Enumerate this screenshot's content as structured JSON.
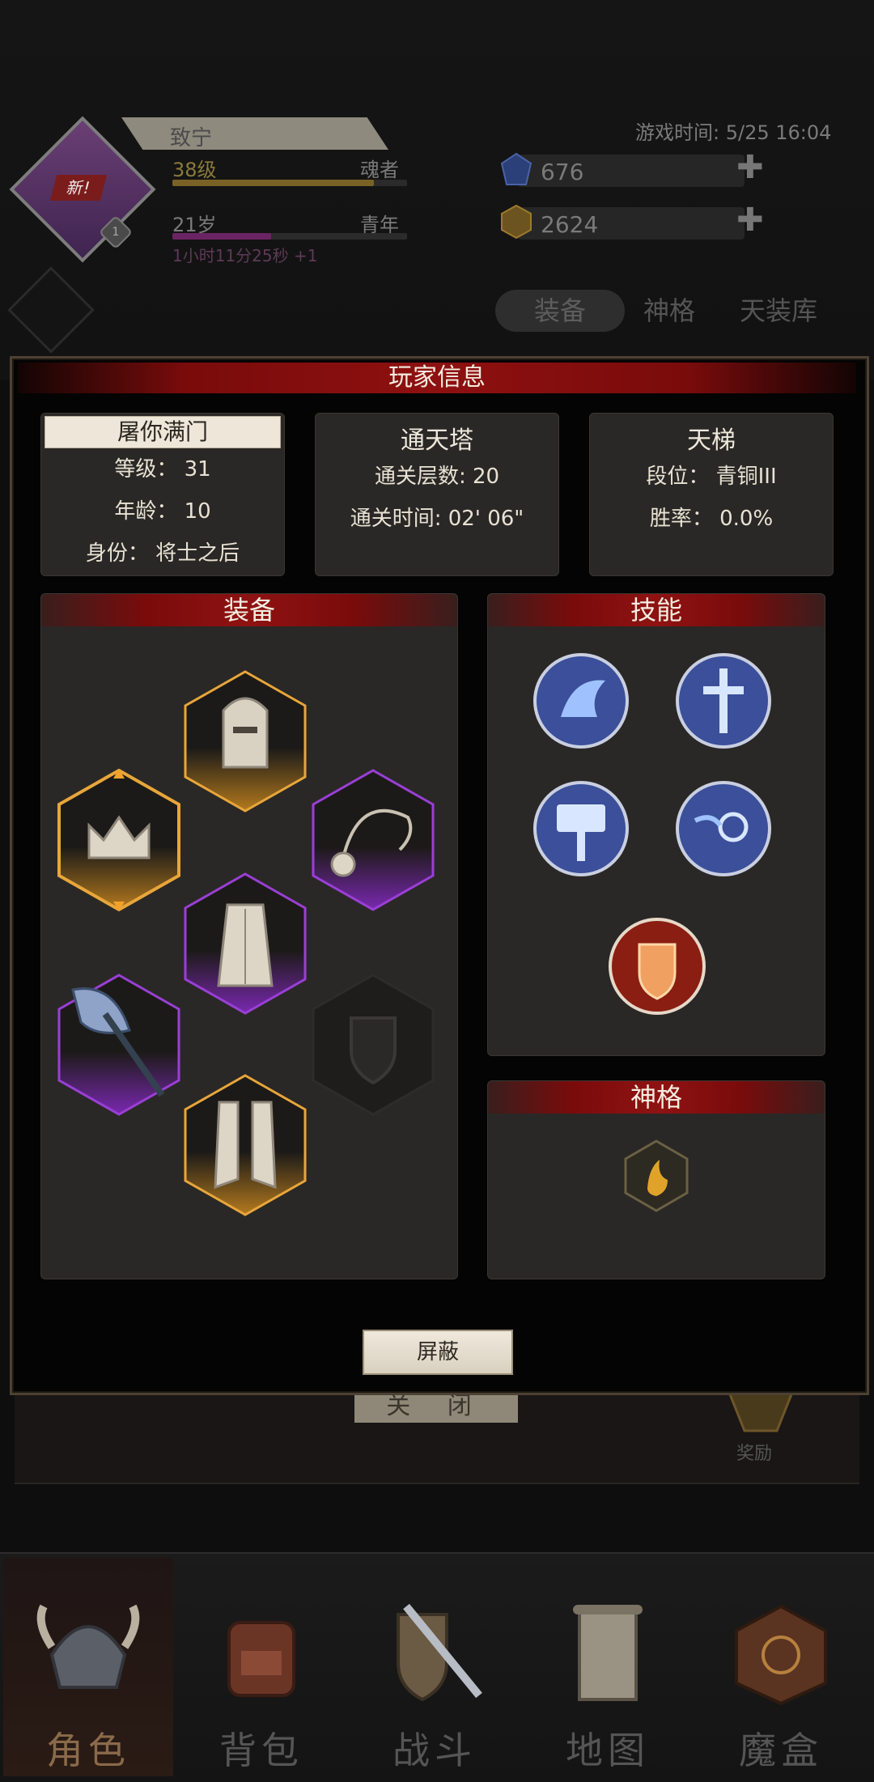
{
  "header": {
    "player_name": "致宁",
    "new_badge": "新!",
    "avatar_level_badge": "1",
    "level_text": "38级",
    "class_text": "魂者",
    "age_text": "21岁",
    "age_stage": "青年",
    "time_bonus": "1小时11分25秒 +1",
    "game_time": "游戏时间: 5/25 16:04",
    "blue_gem_value": "676",
    "gold_gem_value": "2624",
    "plus": "✚",
    "level_progress": 0.86,
    "age_progress": 0.42
  },
  "top_tabs": [
    "装备",
    "神格",
    "天装库"
  ],
  "behind": {
    "close_label": "关 闭",
    "reward_label": "奖励"
  },
  "modal": {
    "title": "玩家信息",
    "profile": {
      "name": "屠你满门",
      "level": "等级： 31",
      "age": "年龄： 10",
      "identity": "身份： 将士之后"
    },
    "tower": {
      "title": "通天塔",
      "floors": "通关层数: 20",
      "time": "通关时间: 02' 06\""
    },
    "ladder": {
      "title": "天梯",
      "rank": "段位： 青铜III",
      "winrate": "胜率： 0.0%"
    },
    "equipment_title": "装备",
    "skills_title": "技能",
    "divinity_title": "神格",
    "block_button": "屏蔽"
  },
  "nav": [
    {
      "label": "角色",
      "icon": "helmet-icon"
    },
    {
      "label": "背包",
      "icon": "backpack-icon"
    },
    {
      "label": "战斗",
      "icon": "sword-shield-icon"
    },
    {
      "label": "地图",
      "icon": "scroll-map-icon"
    },
    {
      "label": "魔盒",
      "icon": "magic-box-icon"
    }
  ],
  "colors": {
    "accent_red": "#8e1010",
    "gold_frame": "#e8a63a",
    "purple_frame": "#9a3fd6",
    "skill_blue": "#3b4f9a"
  }
}
